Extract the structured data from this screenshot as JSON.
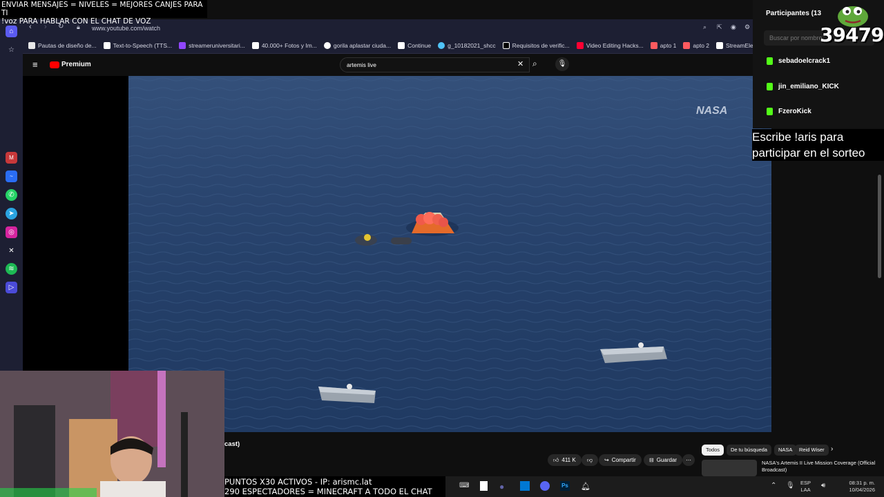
{
  "overlay_top": {
    "line1": "ENVIAR MENSAJES = NIVELES = MEJORES CANJES PARA TI",
    "line2": "!voz PARA HABLAR CON EL CHAT DE VOZ"
  },
  "browser": {
    "url": "www.youtube.com/watch",
    "bookmarks": [
      {
        "label": "Pautas de diseño de...",
        "color": "#e8e8e8"
      },
      {
        "label": "Text-to-Speech (TTS...",
        "color": "#ffffff"
      },
      {
        "label": "streameruniversitari...",
        "color": "#9146ff"
      },
      {
        "label": "40.000+ Fotos y Im...",
        "color": "#ffffff"
      },
      {
        "label": "gorila aplastar ciuda...",
        "color": "#ffffff"
      },
      {
        "label": "Continue",
        "color": "#ffffff"
      },
      {
        "label": "g_10182021_shcc",
        "color": "#4fc3f7"
      },
      {
        "label": "Requisitos de verific...",
        "color": "#ffffff"
      },
      {
        "label": "Video Editing Hacks...",
        "color": "#ff0033"
      },
      {
        "label": "apto 1",
        "color": "#ff5a5f"
      },
      {
        "label": "apto 2",
        "color": "#ff5a5f"
      },
      {
        "label": "StreamElements - st...",
        "color": "#ffffff"
      }
    ]
  },
  "youtube": {
    "logo_label": "Premium",
    "search_value": "artemis live",
    "video_title_fragment": "cast)",
    "likes": "411 K",
    "share_label": "Compartir",
    "save_label": "Guardar",
    "chips": [
      "Todos",
      "De tu búsqueda",
      "NASA",
      "Reid Wiser"
    ],
    "related_title": "NASA's Artemis II Live Mission Coverage (Official Broadcast)"
  },
  "chat_panel": {
    "title": "Participantes (13",
    "search_placeholder": "Buscar por nombre",
    "viewers_badge": "39479",
    "users": [
      "sebadoelcrack1",
      "jin_emiliano_KICK",
      "FzeroKick"
    ]
  },
  "sorteo": {
    "line1": "Escribe !aris para",
    "line2": "participar en el sorteo"
  },
  "bottom_overlay": {
    "line1": "PUNTOS X30 ACTIVOS - IP: arismc.lat",
    "line2": "290 ESPECTADORES = MINECRAFT A TODO EL CHAT"
  },
  "taskbar": {
    "lang1": "ESP",
    "lang2": "LAA",
    "time": "08:31 p. m.",
    "date": "10/04/2026"
  },
  "video": {
    "watermark": "NASA"
  }
}
